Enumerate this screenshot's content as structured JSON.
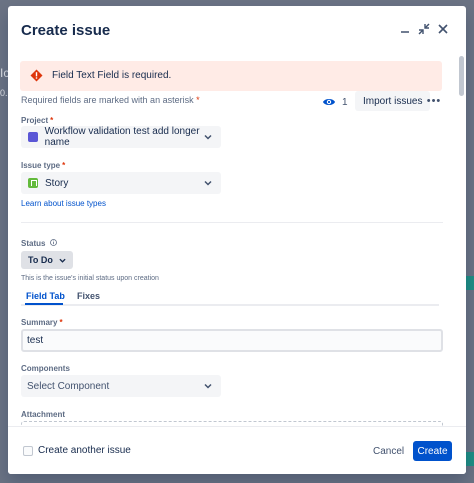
{
  "background": {
    "fragment_1": "Ic",
    "fragment_2": "0."
  },
  "header": {
    "title": "Create issue",
    "minimize_icon": "minimize-icon",
    "collapse_icon": "collapse-icon",
    "close_icon": "close-icon"
  },
  "error_banner": {
    "text": "Field Text Field is required.",
    "icon": "error-icon",
    "color": "#de350b",
    "background": "#ffebe6"
  },
  "required_note": {
    "text": "Required fields are marked with an asterisk",
    "asterisk": "*"
  },
  "toolbar": {
    "watch_count": "1",
    "watch_icon": "eye-icon",
    "import_label": "Import issues",
    "more_label": "•••"
  },
  "project": {
    "label": "Project",
    "required": "*",
    "value": "Workflow validation test add longer name"
  },
  "issue_type": {
    "label": "Issue type",
    "required": "*",
    "value": "Story",
    "learn_link": "Learn about issue types"
  },
  "status": {
    "label": "Status",
    "info_icon": "info-icon",
    "value": "To Do",
    "helper": "This is the issue's initial status upon creation"
  },
  "tabs": [
    {
      "label": "Field Tab",
      "active": true
    },
    {
      "label": "Fixes",
      "active": false
    }
  ],
  "summary": {
    "label": "Summary",
    "required": "*",
    "value": "test"
  },
  "components": {
    "label": "Components",
    "placeholder": "Select Component"
  },
  "attachment": {
    "label": "Attachment"
  },
  "footer": {
    "checkbox_label": "Create another issue",
    "cancel_label": "Cancel",
    "create_label": "Create"
  },
  "colors": {
    "primary": "#0052cc",
    "text": "#172b4d",
    "required": "#de350b"
  }
}
